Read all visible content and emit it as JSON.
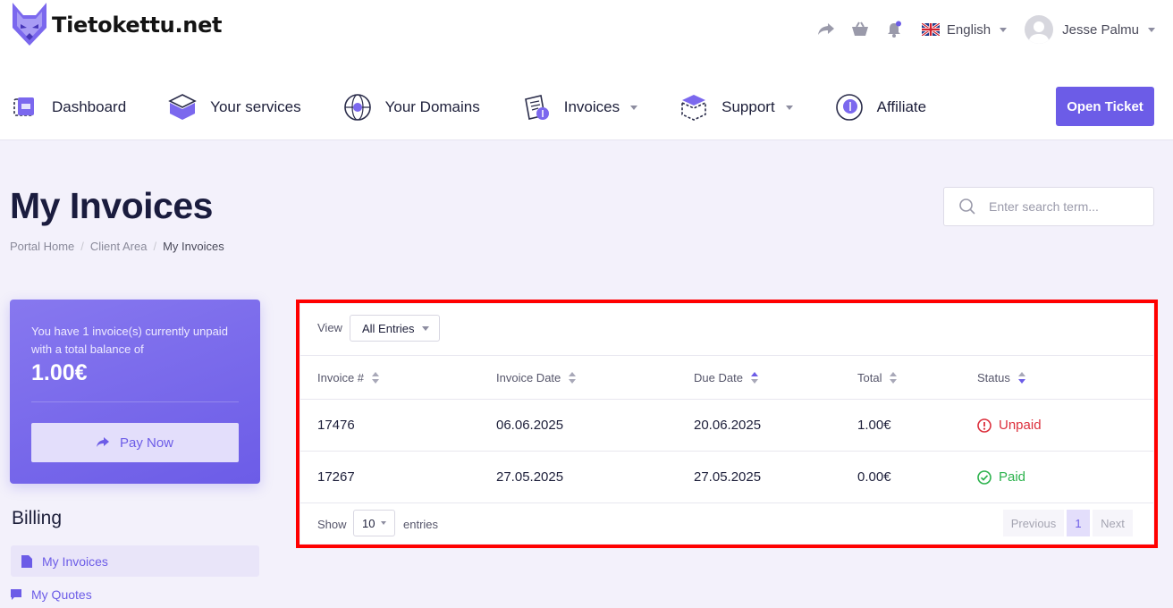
{
  "brand": {
    "name": "Tietokettu.net"
  },
  "header": {
    "language": "English",
    "user_name": "Jesse Palmu"
  },
  "nav": {
    "items": [
      {
        "label": "Dashboard"
      },
      {
        "label": "Your services"
      },
      {
        "label": "Your Domains"
      },
      {
        "label": "Invoices"
      },
      {
        "label": "Support"
      },
      {
        "label": "Affiliate"
      }
    ],
    "open_ticket_label": "Open Ticket"
  },
  "page": {
    "title": "My Invoices",
    "breadcrumb": [
      "Portal Home",
      "Client Area",
      "My Invoices"
    ],
    "search_placeholder": "Enter search term..."
  },
  "balance": {
    "message": "You have 1 invoice(s) currently unpaid with a total balance of",
    "amount": "1.00€",
    "pay_label": "Pay Now"
  },
  "sidebar": {
    "title": "Billing",
    "items": [
      {
        "label": "My Invoices"
      },
      {
        "label": "My Quotes"
      }
    ]
  },
  "table": {
    "view_label": "View",
    "view_value": "All Entries",
    "columns": [
      "Invoice #",
      "Invoice Date",
      "Due Date",
      "Total",
      "Status"
    ],
    "rows": [
      {
        "invoice": "17476",
        "invoice_date": "06.06.2025",
        "due_date": "20.06.2025",
        "total": "1.00€",
        "status": "Unpaid"
      },
      {
        "invoice": "17267",
        "invoice_date": "27.05.2025",
        "due_date": "27.05.2025",
        "total": "0.00€",
        "status": "Paid"
      }
    ],
    "show_label": "Show",
    "length_value": "10",
    "entries_label": "entries",
    "pager": {
      "previous": "Previous",
      "current": "1",
      "next": "Next"
    }
  },
  "colors": {
    "accent": "#6c5ce7",
    "unpaid": "#dc2f3c",
    "paid": "#2bb24c",
    "highlight": "#ff0000"
  }
}
